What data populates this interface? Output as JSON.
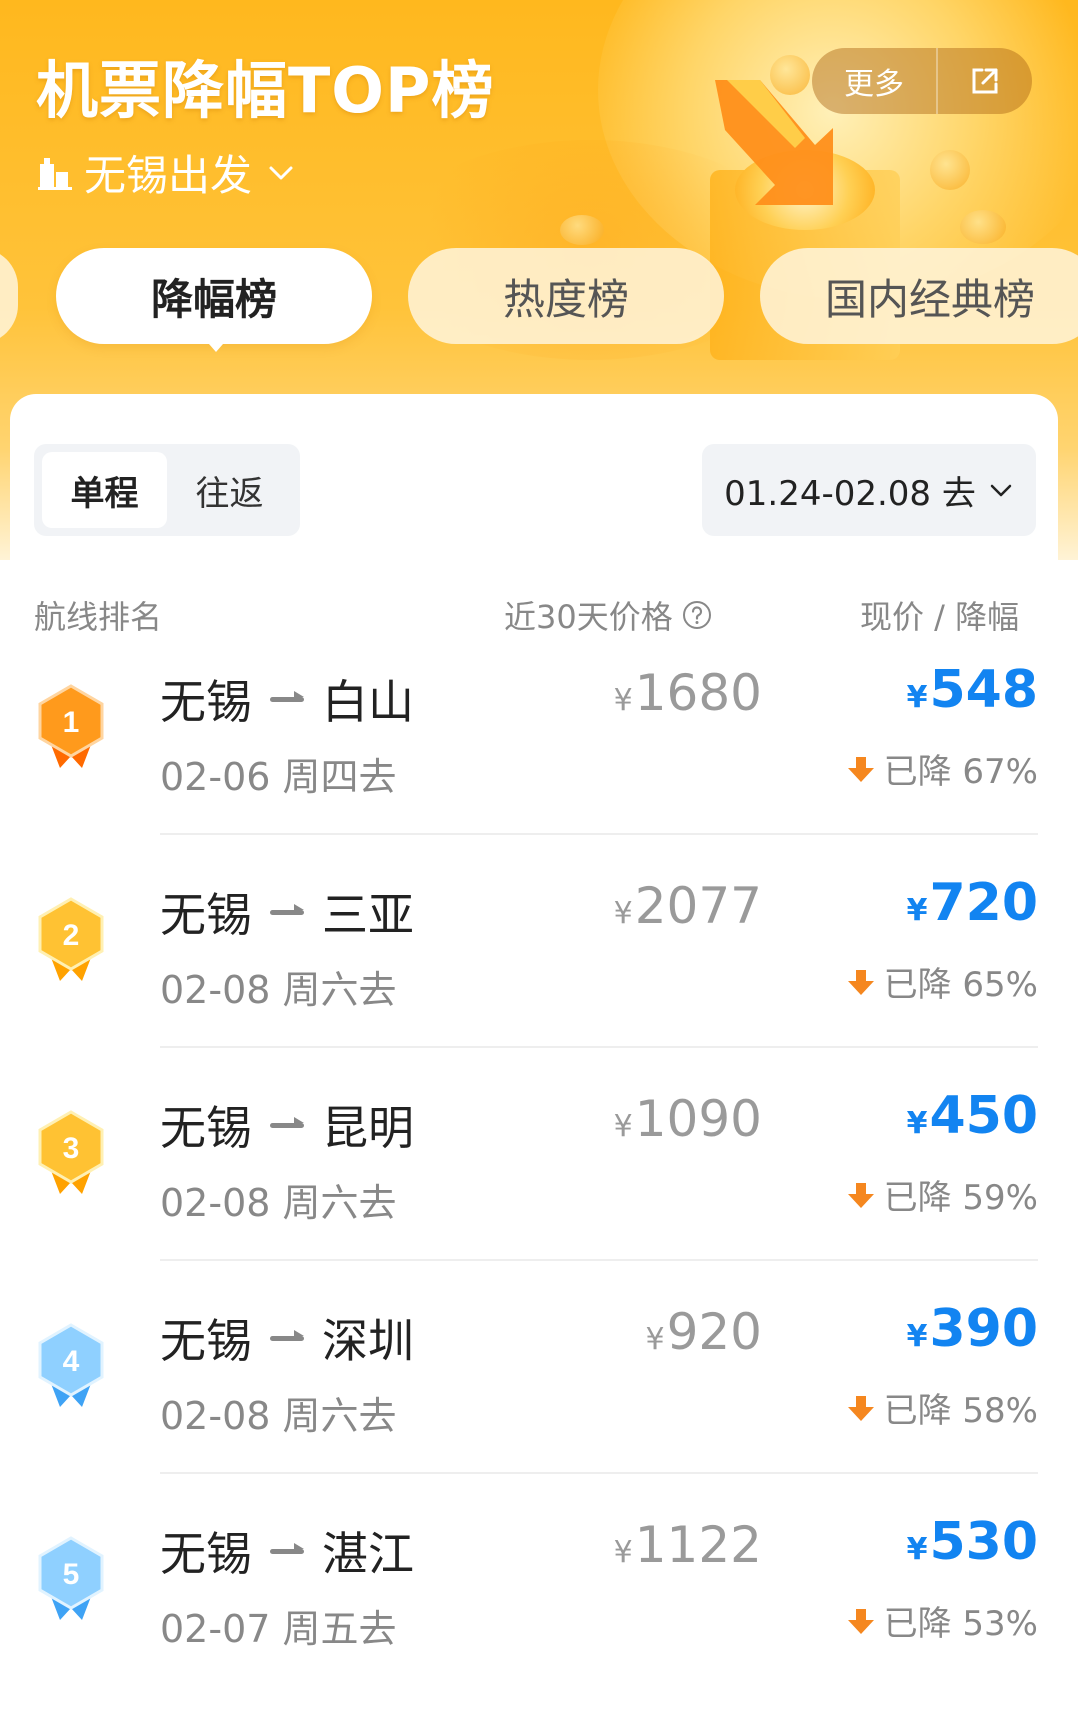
{
  "header": {
    "title": "机票降幅TOP榜",
    "origin": "无锡出发",
    "more_label": "更多"
  },
  "tabs": [
    {
      "label": "降幅榜",
      "active": true
    },
    {
      "label": "热度榜",
      "active": false
    },
    {
      "label": "国内经典榜",
      "active": false
    }
  ],
  "filters": {
    "trip_types": [
      "单程",
      "往返"
    ],
    "selected_trip_type": "单程",
    "date_range": "01.24-02.08 去"
  },
  "columns": {
    "route_rank": "航线排名",
    "past_price": "近30天价格",
    "current": "现价 / 降幅"
  },
  "currency_symbol": "¥",
  "colors": {
    "accent_blue": "#1284f1",
    "hero_orange": "#ffb81e",
    "drop_arrow": "#f5871f"
  },
  "flights": [
    {
      "rank": "1",
      "from": "无锡",
      "to": "白山",
      "depart": "02-06 周四去",
      "past_price": "1680",
      "price": "548",
      "drop": "已降 67%"
    },
    {
      "rank": "2",
      "from": "无锡",
      "to": "三亚",
      "depart": "02-08 周六去",
      "past_price": "2077",
      "price": "720",
      "drop": "已降 65%"
    },
    {
      "rank": "3",
      "from": "无锡",
      "to": "昆明",
      "depart": "02-08 周六去",
      "past_price": "1090",
      "price": "450",
      "drop": "已降 59%"
    },
    {
      "rank": "4",
      "from": "无锡",
      "to": "深圳",
      "depart": "02-08 周六去",
      "past_price": "920",
      "price": "390",
      "drop": "已降 58%"
    },
    {
      "rank": "5",
      "from": "无锡",
      "to": "湛江",
      "depart": "02-07 周五去",
      "past_price": "1122",
      "price": "530",
      "drop": "已降 53%"
    }
  ]
}
